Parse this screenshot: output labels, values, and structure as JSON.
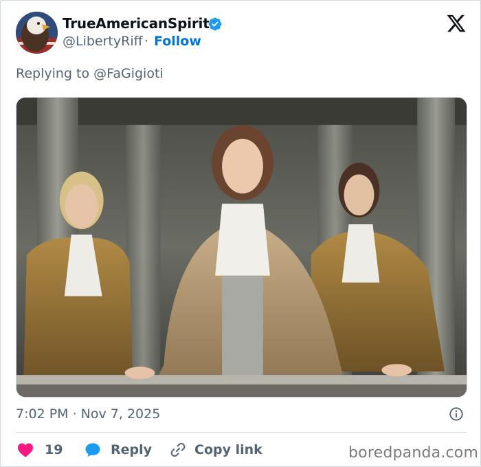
{
  "tweet": {
    "display_name": "TrueAmericanSpirit",
    "handle": "@LibertyRiff",
    "separator": "·",
    "follow_label": "Follow",
    "replying_to": "Replying to @FaGigioti",
    "timestamp": "7:02 PM · Nov 7, 2025",
    "verified": true
  },
  "actions": {
    "like_count": "19",
    "reply_label": "Reply",
    "copy_link_label": "Copy link"
  },
  "media": {
    "description_icon": "photo",
    "type": "image"
  },
  "colors": {
    "accent": "#0074d4",
    "like": "#f91880",
    "secondary_text": "#536471",
    "verified": "#1d9bf0"
  },
  "icons": {
    "verified": "verified-badge-icon",
    "logo": "x-logo-icon",
    "info": "info-icon",
    "like": "heart-icon",
    "reply": "speech-bubble-icon",
    "copy": "link-icon"
  },
  "watermark": "boredpanda.com"
}
